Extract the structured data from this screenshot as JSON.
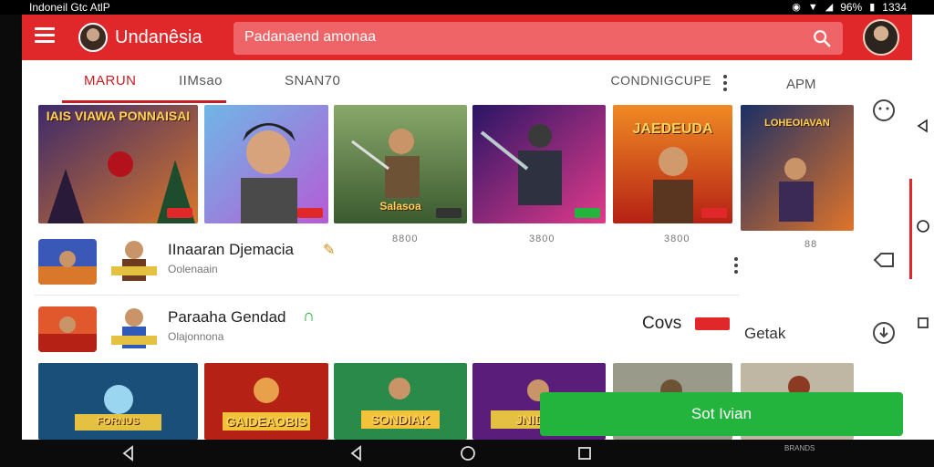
{
  "status_bar": {
    "left_text": "Indoneil Gtc AtlP",
    "battery": "96%",
    "time": "1334"
  },
  "app_bar": {
    "title": "Undanêsia",
    "search_text": "Padanaend amonaa"
  },
  "tabs": [
    {
      "label": "MARUN"
    },
    {
      "label": "IIMsao"
    },
    {
      "label": "SNAN70"
    }
  ],
  "more_label": "CONDNIGCUPE",
  "overlay": {
    "top_label": "APM",
    "mid_label": "Getak"
  },
  "featured_cards": [
    {
      "title": "IAIS VIAWA PONNAISAI"
    },
    {
      "title": ""
    },
    {
      "title": "Salasoa"
    },
    {
      "title": ""
    },
    {
      "title": "JAEDEUDA"
    },
    {
      "title": "LOHEOIAVAN"
    }
  ],
  "download_counts": [
    "8800",
    "3800",
    "3800",
    "88"
  ],
  "list_items": [
    {
      "title": "IInaaran Djemacia",
      "subtitle": "Oolenaain"
    },
    {
      "title": "Paraaha Gendad",
      "subtitle": "Olajonnona",
      "value": "Covs"
    }
  ],
  "bottom_cards": [
    {
      "title": "FORNUS"
    },
    {
      "title": "GAIDEAOBIS"
    },
    {
      "title": "SONDIAK"
    },
    {
      "title": "JNIDAN"
    },
    {
      "title": ""
    }
  ],
  "cta_label": "Sot Ivian",
  "nav": {
    "brand": "BRANDS"
  },
  "colors": {
    "primary": "#e0282b",
    "accent": "#c81d22",
    "success": "#22b43c"
  }
}
